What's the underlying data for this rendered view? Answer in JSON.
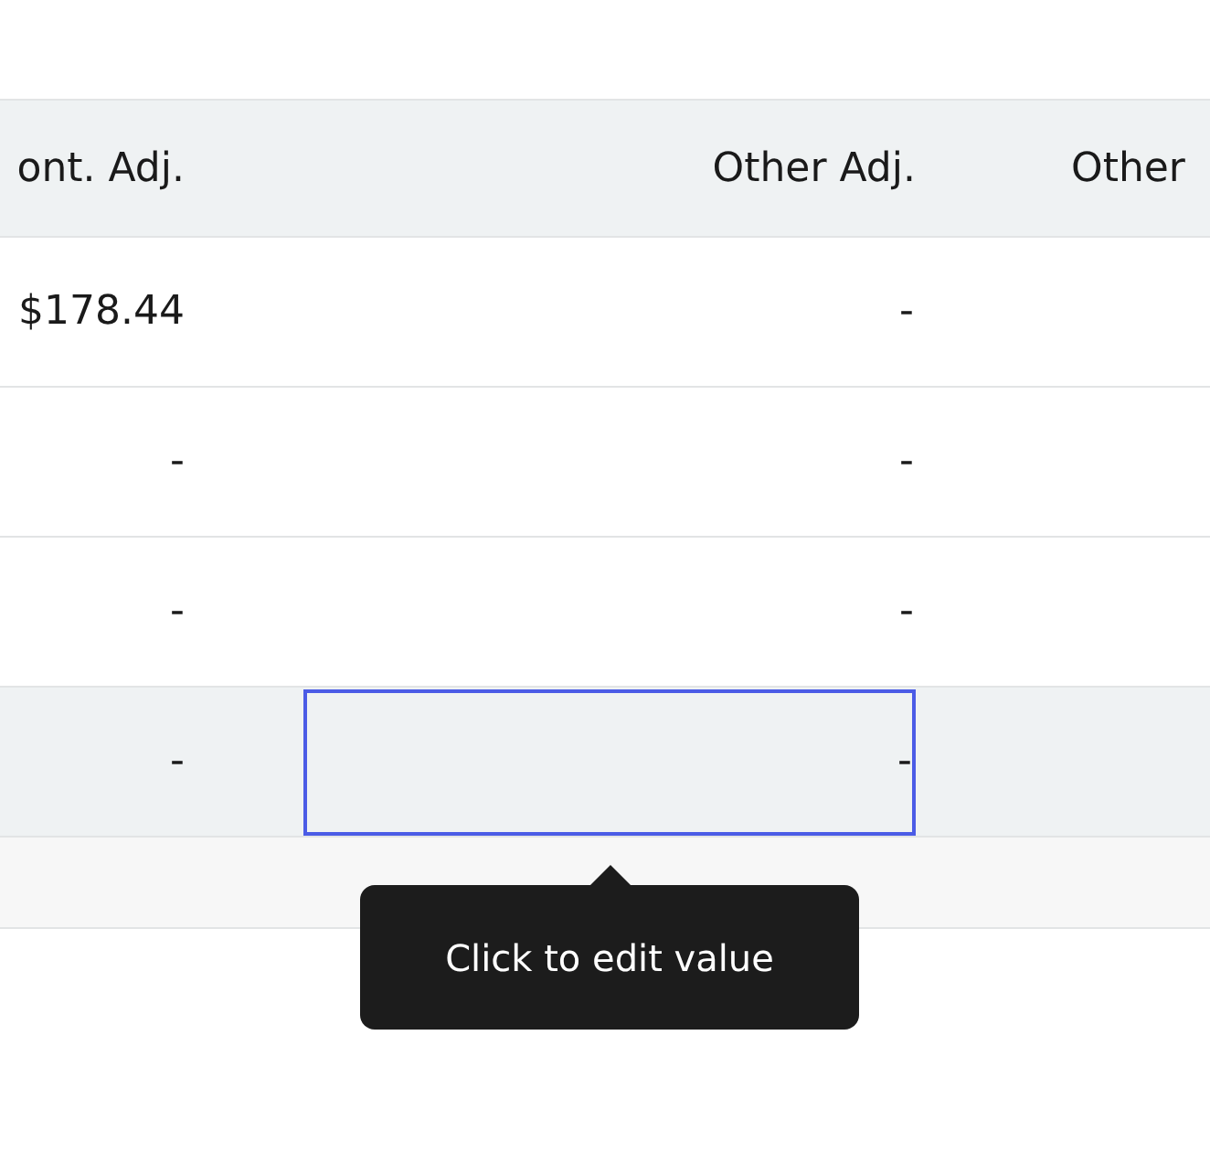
{
  "table": {
    "columns": [
      "ont. Adj.",
      "Other Adj.",
      "Other"
    ],
    "rows": [
      {
        "cont_adj": "$178.44",
        "other_adj": "-",
        "selected": false,
        "editing": false
      },
      {
        "cont_adj": "-",
        "other_adj": "-",
        "selected": false,
        "editing": false
      },
      {
        "cont_adj": "-",
        "other_adj": "-",
        "selected": false,
        "editing": false
      },
      {
        "cont_adj": "-",
        "other_adj": "-",
        "selected": true,
        "editing": true
      }
    ]
  },
  "tooltip": {
    "text": "Click to edit value"
  }
}
